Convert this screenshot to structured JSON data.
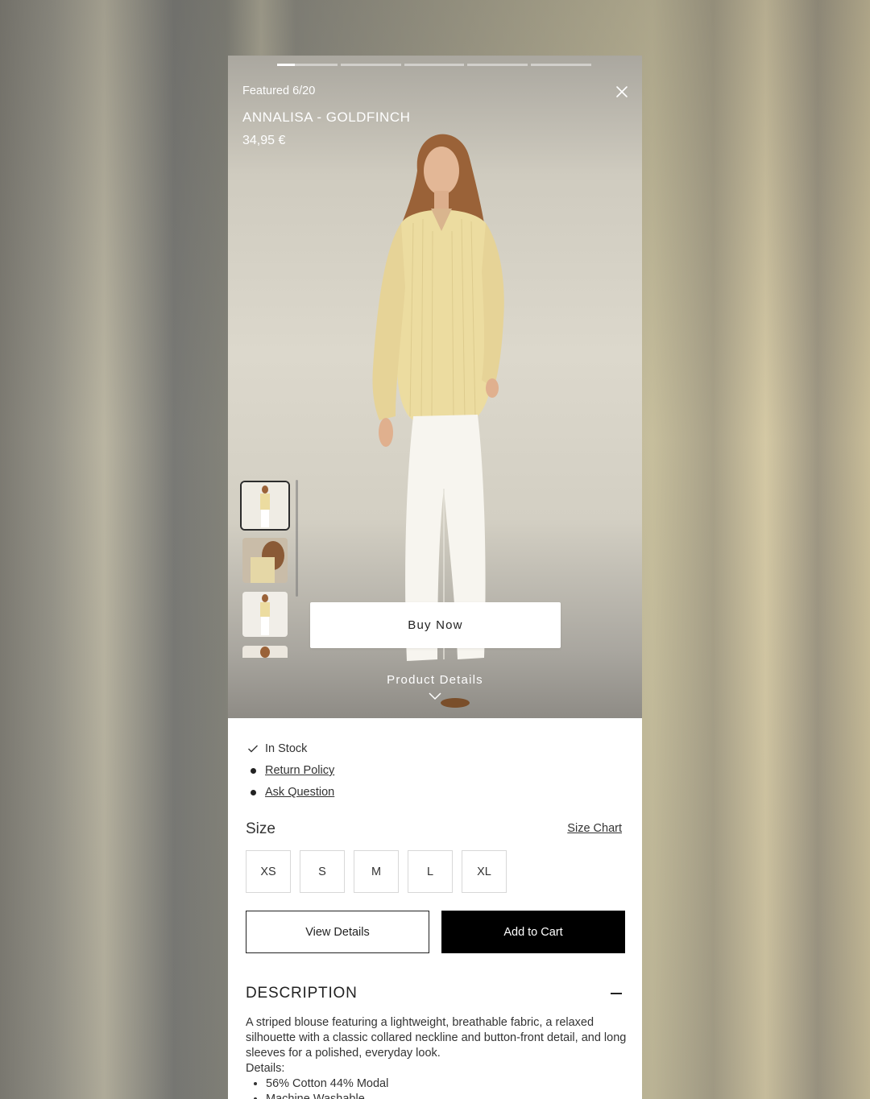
{
  "story": {
    "counter": "Featured 6/20",
    "progress_segments": 5,
    "progress_active_index": 0,
    "progress_active_fraction": 0.3
  },
  "product": {
    "title": "ANNALISA - GOLDFINCH",
    "price": "34,95 €"
  },
  "icons": {
    "close": "close-icon",
    "chevron": "chevron-down-icon",
    "check": "check-icon"
  },
  "actions": {
    "buy_now": "Buy Now",
    "product_details": "Product Details",
    "view_details": "View Details",
    "add_to_cart": "Add to Cart"
  },
  "info": {
    "stock": "In Stock",
    "return_policy": "Return Policy",
    "ask_question": "Ask Question"
  },
  "size": {
    "label": "Size",
    "chart_link": "Size Chart",
    "options": [
      "XS",
      "S",
      "M",
      "L",
      "XL"
    ]
  },
  "description": {
    "heading": "DESCRIPTION",
    "text": "A striped blouse featuring a lightweight, breathable fabric, a relaxed silhouette with a classic collared neckline and button-front detail, and long sleeves for a polished, everyday look.",
    "details_label": "Details:",
    "details": [
      "56% Cotton 44% Modal",
      "Machine Washable"
    ]
  },
  "colors": {
    "button_dark": "#000000",
    "shirt": "#ecdca0",
    "text": "#333333"
  }
}
